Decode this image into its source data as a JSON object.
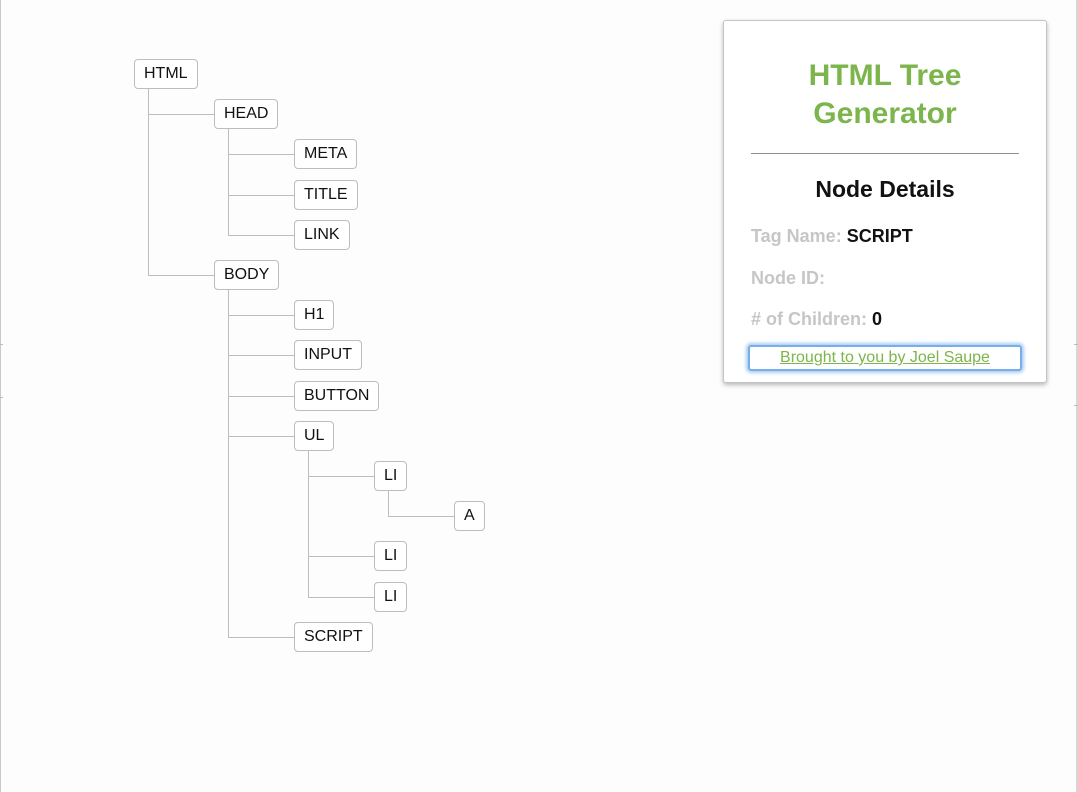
{
  "app": {
    "title_line1": "HTML Tree",
    "title_line2": "Generator",
    "accent_color": "#7cb54b"
  },
  "tree": {
    "nodes": [
      {
        "id": "html",
        "tag": "HTML",
        "depth": 0,
        "children": 2
      },
      {
        "id": "head",
        "tag": "HEAD",
        "depth": 1,
        "children": 3
      },
      {
        "id": "meta",
        "tag": "META",
        "depth": 2,
        "children": 0
      },
      {
        "id": "title",
        "tag": "TITLE",
        "depth": 2,
        "children": 0
      },
      {
        "id": "link",
        "tag": "LINK",
        "depth": 2,
        "children": 0
      },
      {
        "id": "body",
        "tag": "BODY",
        "depth": 1,
        "children": 5
      },
      {
        "id": "h1",
        "tag": "H1",
        "depth": 2,
        "children": 0
      },
      {
        "id": "input",
        "tag": "INPUT",
        "depth": 2,
        "children": 0
      },
      {
        "id": "button",
        "tag": "BUTTON",
        "depth": 2,
        "children": 0
      },
      {
        "id": "ul",
        "tag": "UL",
        "depth": 2,
        "children": 3
      },
      {
        "id": "li1",
        "tag": "LI",
        "depth": 3,
        "children": 1
      },
      {
        "id": "a",
        "tag": "A",
        "depth": 4,
        "children": 0
      },
      {
        "id": "li2",
        "tag": "LI",
        "depth": 3,
        "children": 0
      },
      {
        "id": "li3",
        "tag": "LI",
        "depth": 3,
        "children": 0
      },
      {
        "id": "script",
        "tag": "SCRIPT",
        "depth": 2,
        "children": 0
      }
    ]
  },
  "details": {
    "heading": "Node Details",
    "tag_label": "Tag Name:",
    "tag_value": "SCRIPT",
    "id_label": "Node ID:",
    "id_value": "",
    "children_label": "# of Children:",
    "children_value": "0"
  },
  "credit": {
    "link_text": "Brought to you by Joel Saupe",
    "focus_color": "#79aee8"
  }
}
